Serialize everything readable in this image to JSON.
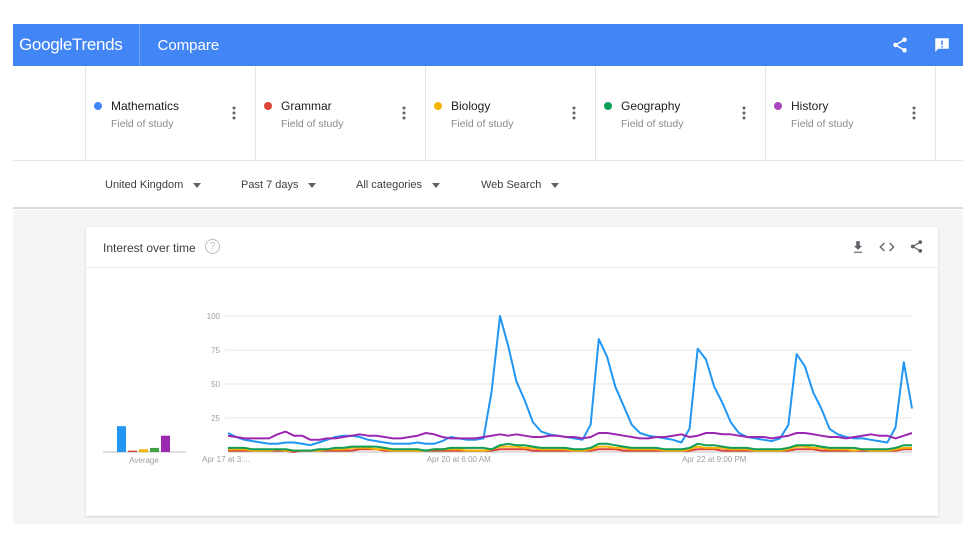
{
  "header": {
    "logo_google": "Google",
    "logo_trends": "Trends",
    "page_title": "Compare",
    "share_icon": "share-icon",
    "feedback_icon": "feedback-icon"
  },
  "terms": [
    {
      "name": "Mathematics",
      "type": "Field of study",
      "color": "#4285f4"
    },
    {
      "name": "Grammar",
      "type": "Field of study",
      "color": "#db4437"
    },
    {
      "name": "Biology",
      "type": "Field of study",
      "color": "#f4b400"
    },
    {
      "name": "Geography",
      "type": "Field of study",
      "color": "#0f9d58"
    },
    {
      "name": "History",
      "type": "Field of study",
      "color": "#ab47bc"
    }
  ],
  "filters": {
    "region": "United Kingdom",
    "time": "Past 7 days",
    "category": "All categories",
    "search_type": "Web Search"
  },
  "card": {
    "title": "Interest over time",
    "help_icon": "?",
    "download_icon": "download-icon",
    "embed_icon": "embed-icon",
    "share_icon": "share-icon"
  },
  "chart_data": {
    "type": "line",
    "title": "Interest over time",
    "xlabel": "",
    "ylabel": "",
    "ylim": [
      0,
      100
    ],
    "yticks": [
      25,
      50,
      75,
      100
    ],
    "grid": true,
    "x_tick_labels": [
      "Apr 17 at 3:...",
      "Apr 20 at 6:00 AM",
      "Apr 22 at 9:00 PM"
    ],
    "x_tick_index": [
      0,
      28,
      59
    ],
    "average_label": "Average",
    "averages": [
      {
        "name": "Mathematics",
        "value": 19
      },
      {
        "name": "Grammar",
        "value": 1
      },
      {
        "name": "Biology",
        "value": 2
      },
      {
        "name": "Geography",
        "value": 3
      },
      {
        "name": "History",
        "value": 12
      }
    ],
    "series": [
      {
        "name": "Mathematics",
        "color": "#2196f3",
        "values": [
          14,
          11,
          9,
          8,
          7,
          6,
          6,
          7,
          7,
          6,
          5,
          7,
          9,
          11,
          12,
          12,
          11,
          9,
          8,
          7,
          6,
          6,
          6,
          7,
          6,
          6,
          8,
          11,
          10,
          9,
          9,
          10,
          45,
          100,
          78,
          52,
          38,
          22,
          15,
          13,
          12,
          11,
          10,
          9,
          20,
          83,
          70,
          48,
          34,
          20,
          14,
          12,
          11,
          10,
          9,
          7,
          17,
          76,
          68,
          48,
          36,
          22,
          14,
          11,
          10,
          9,
          8,
          10,
          20,
          72,
          63,
          44,
          32,
          17,
          13,
          11,
          10,
          10,
          9,
          8,
          7,
          18,
          66,
          32
        ]
      },
      {
        "name": "Grammar",
        "color": "#db4437",
        "values": [
          1,
          1,
          1,
          1,
          1,
          1,
          1,
          1,
          0,
          1,
          1,
          1,
          1,
          1,
          1,
          1,
          2,
          2,
          2,
          1,
          1,
          1,
          1,
          1,
          1,
          1,
          1,
          1,
          1,
          1,
          1,
          1,
          1,
          2,
          2,
          2,
          2,
          1,
          1,
          1,
          1,
          1,
          1,
          1,
          1,
          2,
          2,
          2,
          1,
          1,
          1,
          1,
          1,
          1,
          1,
          1,
          1,
          2,
          2,
          2,
          1,
          1,
          1,
          1,
          1,
          1,
          1,
          1,
          1,
          2,
          2,
          2,
          1,
          1,
          1,
          1,
          1,
          1,
          1,
          1,
          1,
          1,
          2,
          2
        ]
      },
      {
        "name": "Biology",
        "color": "#f4b400",
        "values": [
          2,
          2,
          2,
          1,
          1,
          1,
          2,
          1,
          1,
          1,
          1,
          1,
          2,
          2,
          2,
          3,
          3,
          3,
          2,
          2,
          1,
          1,
          1,
          1,
          1,
          2,
          2,
          2,
          2,
          1,
          1,
          1,
          2,
          4,
          4,
          4,
          3,
          3,
          2,
          2,
          2,
          2,
          1,
          1,
          2,
          4,
          4,
          3,
          3,
          2,
          2,
          2,
          2,
          1,
          1,
          1,
          2,
          4,
          3,
          3,
          3,
          2,
          2,
          2,
          1,
          1,
          1,
          1,
          2,
          4,
          4,
          3,
          3,
          2,
          2,
          2,
          1,
          2,
          1,
          1,
          1,
          2,
          3,
          3
        ]
      },
      {
        "name": "Geography",
        "color": "#0f9d58",
        "values": [
          3,
          3,
          3,
          2,
          2,
          2,
          2,
          2,
          1,
          1,
          1,
          2,
          2,
          3,
          3,
          4,
          4,
          4,
          4,
          3,
          2,
          2,
          2,
          2,
          1,
          2,
          2,
          3,
          3,
          3,
          3,
          3,
          2,
          5,
          6,
          5,
          5,
          4,
          3,
          3,
          3,
          3,
          2,
          2,
          3,
          6,
          6,
          5,
          4,
          3,
          3,
          3,
          3,
          2,
          2,
          2,
          3,
          6,
          5,
          5,
          4,
          3,
          3,
          3,
          2,
          2,
          2,
          2,
          3,
          5,
          5,
          5,
          4,
          3,
          3,
          3,
          3,
          2,
          2,
          2,
          2,
          3,
          5,
          5
        ]
      },
      {
        "name": "History",
        "color": "#9c27b0",
        "values": [
          12,
          11,
          10,
          10,
          10,
          10,
          13,
          15,
          12,
          12,
          9,
          9,
          10,
          10,
          11,
          12,
          13,
          12,
          12,
          11,
          10,
          10,
          11,
          12,
          14,
          13,
          11,
          10,
          10,
          10,
          10,
          11,
          12,
          13,
          12,
          13,
          12,
          11,
          11,
          12,
          12,
          11,
          11,
          10,
          11,
          14,
          14,
          13,
          12,
          11,
          10,
          10,
          11,
          11,
          12,
          13,
          11,
          12,
          14,
          14,
          13,
          13,
          12,
          11,
          11,
          11,
          10,
          11,
          12,
          14,
          14,
          13,
          12,
          11,
          11,
          10,
          11,
          12,
          13,
          12,
          12,
          10,
          12,
          14
        ]
      }
    ]
  }
}
